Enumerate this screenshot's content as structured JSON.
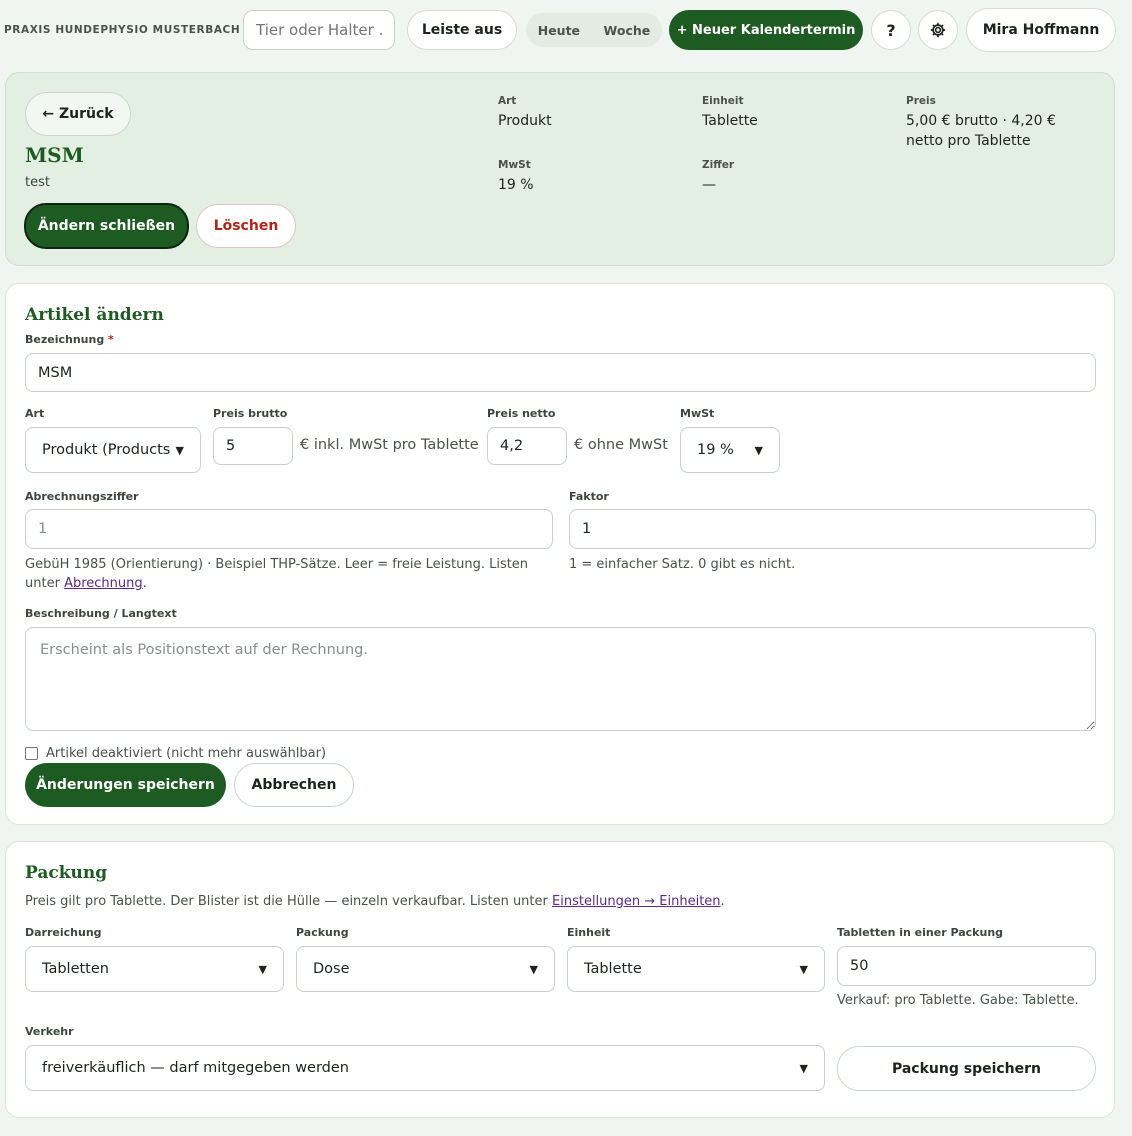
{
  "topbar": {
    "brand": "PRAXIS HUNDEPHYSIO MUSTERBACH",
    "search_placeholder": "Tier oder Halter ...",
    "toggle_bar": "Leiste aus",
    "seg_today": "Heute",
    "seg_week": "Woche",
    "new_event": "+ Neuer Kalendertermin",
    "help": "?",
    "settings_icon": "gear-icon",
    "user": "Mira Hoffmann"
  },
  "header": {
    "back": "← Zurück",
    "title": "MSM",
    "subtitle": "test",
    "edit_close": "Ändern schließen",
    "delete": "Löschen",
    "meta": {
      "art_label": "Art",
      "art_value": "Produkt",
      "einheit_label": "Einheit",
      "einheit_value": "Tablette",
      "preis_label": "Preis",
      "preis_value": "5,00 € brutto · 4,20 € netto pro Tablette",
      "mwst_label": "MwSt",
      "mwst_value": "19 %",
      "ziffer_label": "Ziffer",
      "ziffer_value": "—"
    }
  },
  "edit": {
    "title": "Artikel ändern",
    "name_label": "Bezeichnung",
    "name_required": "*",
    "name_value": "MSM",
    "art_label": "Art",
    "art_value": "Produkt (Products",
    "brutto_label": "Preis brutto",
    "brutto_value": "5",
    "brutto_unit": "€ inkl. MwSt pro Tablette",
    "netto_label": "Preis netto",
    "netto_value": "4,2",
    "netto_unit": "€ ohne MwSt",
    "mwst_label": "MwSt",
    "mwst_value": "19 %",
    "ziffer_label": "Abrechnungsziffer",
    "ziffer_placeholder": "1",
    "ziffer_hint": "GebüH 1985 (Orientierung) · Beispiel THP-Sätze. Leer = freie Leistung. Listen unter",
    "ziffer_hint_link": "Abrechnung",
    "faktor_label": "Faktor",
    "faktor_value": "1",
    "faktor_hint": "1 = einfacher Satz. 0 gibt es nicht.",
    "desc_label": "Beschreibung / Langtext",
    "desc_placeholder": "Erscheint als Positionstext auf der Rechnung.",
    "deactivated_label": "Artikel deaktiviert (nicht mehr auswählbar)",
    "save": "Änderungen speichern",
    "cancel": "Abbrechen"
  },
  "pack": {
    "title": "Packung",
    "intro": "Preis gilt pro Tablette. Der Blister ist die Hülle — einzeln verkaufbar. Listen unter",
    "intro_link": "Einstellungen → Einheiten",
    "darreichung_label": "Darreichung",
    "darreichung_value": "Tabletten",
    "packung_label": "Packung",
    "packung_value": "Dose",
    "einheit_label": "Einheit",
    "einheit_value": "Tablette",
    "count_label": "Tabletten in einer Packung",
    "count_value": "50",
    "count_hint": "Verkauf: pro Tablette. Gabe: Tablette.",
    "verkehr_label": "Verkehr",
    "verkehr_value": "freiverkäuflich — darf mitgegeben werden",
    "save": "Packung speichern"
  }
}
